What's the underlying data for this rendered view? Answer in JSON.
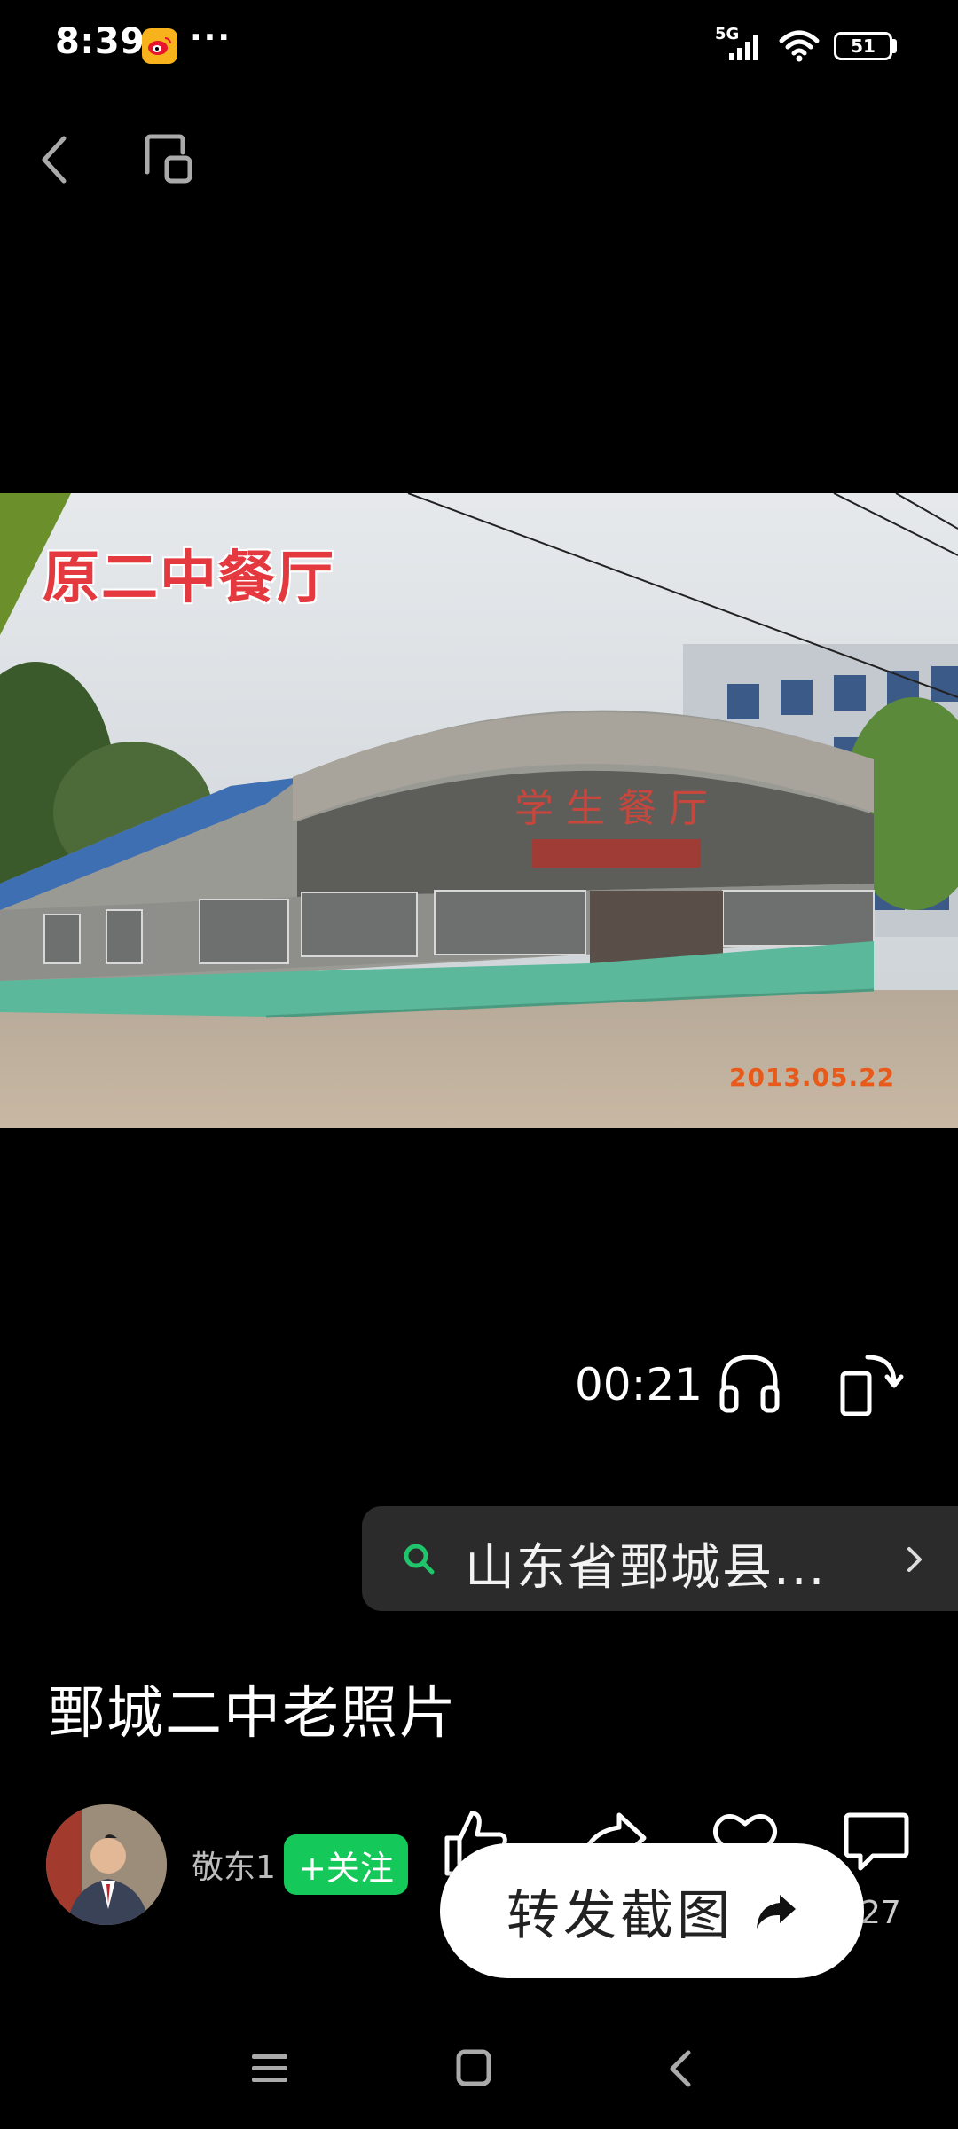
{
  "status_bar": {
    "time": "8:39",
    "dots": "···",
    "network": "5G",
    "battery": "51"
  },
  "photo": {
    "caption": "原二中餐厅",
    "sign_text": "学 生 餐 厅",
    "date_stamp": "2013.05.22"
  },
  "player": {
    "elapsed": "00:21"
  },
  "search": {
    "query": "山东省鄄城县..."
  },
  "video": {
    "title": "鄄城二中老照片"
  },
  "author": {
    "name": "敬东1",
    "follow_label": "+关注"
  },
  "actions": {
    "comment_count": "27",
    "share_screenshot_label": "转发截图"
  },
  "colors": {
    "follow_green": "#14c95a",
    "caption_red": "#e53940",
    "date_orange": "#e85a1a"
  }
}
